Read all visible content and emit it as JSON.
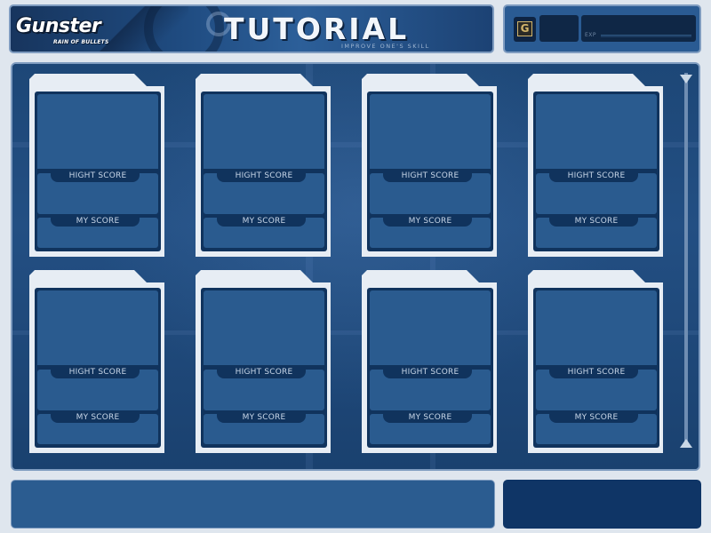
{
  "header": {
    "logo_main": "Gunster",
    "logo_sub": "RAIN OF BULLETS",
    "title": "TUTORIAL",
    "subtitle": "IMPROVE ONE'S SKILL"
  },
  "player": {
    "grade": "G",
    "exp_label": "EXP",
    "exp_progress": 0
  },
  "cards": [
    {
      "high_score_label": "HIGHT SCORE",
      "my_score_label": "MY SCORE"
    },
    {
      "high_score_label": "HIGHT SCORE",
      "my_score_label": "MY SCORE"
    },
    {
      "high_score_label": "HIGHT SCORE",
      "my_score_label": "MY SCORE"
    },
    {
      "high_score_label": "HIGHT SCORE",
      "my_score_label": "MY SCORE"
    },
    {
      "high_score_label": "HIGHT SCORE",
      "my_score_label": "MY SCORE"
    },
    {
      "high_score_label": "HIGHT SCORE",
      "my_score_label": "MY SCORE"
    },
    {
      "high_score_label": "HIGHT SCORE",
      "my_score_label": "MY SCORE"
    },
    {
      "high_score_label": "HIGHT SCORE",
      "my_score_label": "MY SCORE"
    }
  ],
  "colors": {
    "panel_blue": "#2a5b8f",
    "panel_dark": "#10335d",
    "card_frame": "#e7edf4",
    "label_text": "#c7d6e8"
  },
  "icons": {
    "scroll_up": "triangle-down-icon",
    "scroll_down": "triangle-up-icon",
    "grade": "grade-g-icon"
  }
}
